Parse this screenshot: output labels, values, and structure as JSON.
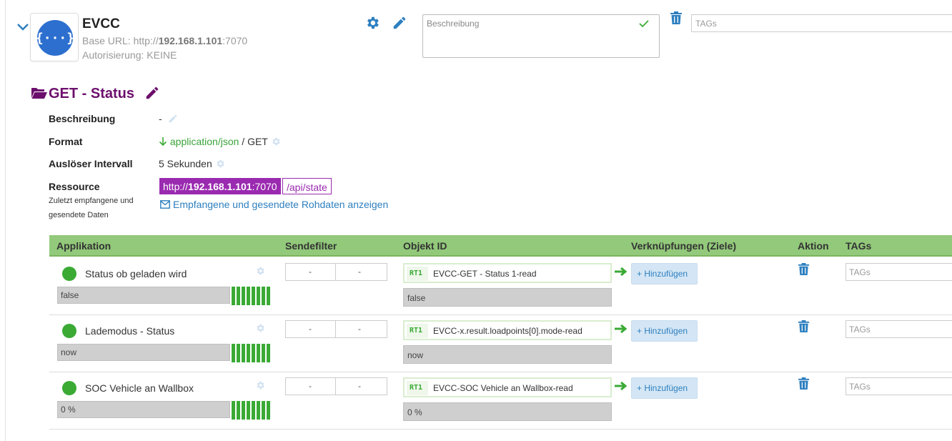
{
  "header": {
    "title": "EVCC",
    "base_url_label": "Base URL: http://",
    "base_url_host": "192.168.1.101",
    "base_url_port": ":7070",
    "auth": "Autorisierung: KEINE",
    "description_placeholder": "Beschreibung",
    "tags_placeholder": "TAGs"
  },
  "section": {
    "title": "GET - Status",
    "beschreibung_label": "Beschreibung",
    "beschreibung_value": "-",
    "format_label": "Format",
    "format_value": "application/json",
    "format_method": "/ GET",
    "intervall_label": "Auslöser Intervall",
    "intervall_value": "5 Sekunden",
    "ressource_label": "Ressource",
    "ressource_sub1": "Zuletzt empfangene und",
    "ressource_sub2": "gesendete Daten",
    "res_prefix": "http://",
    "res_host": "192.168.1.101",
    "res_port": ":7070",
    "res_path": "/api/state",
    "raw_link": "Empfangene und gesendete Rohdaten anzeigen"
  },
  "table": {
    "columns": [
      "Applikation",
      "Sendefilter",
      "Objekt ID",
      "Verknüpfungen (Ziele)",
      "Aktion",
      "TAGs"
    ],
    "rows": [
      {
        "name": "Status ob geladen wird",
        "value": "false",
        "filter_a": "-",
        "filter_b": "-",
        "rt": "RT1",
        "object": "EVCC-GET - Status 1-read",
        "object_value": "false",
        "add_label": "+ Hinzufügen",
        "tags_placeholder": "TAGs"
      },
      {
        "name": "Lademodus - Status",
        "value": "now",
        "filter_a": "-",
        "filter_b": "-",
        "rt": "RT1",
        "object": "EVCC-x.result.loadpoints[0].mode-read",
        "object_value": "now",
        "add_label": "+ Hinzufügen",
        "tags_placeholder": "TAGs"
      },
      {
        "name": "SOC Vehicle an Wallbox",
        "value": "0 %",
        "filter_a": "-",
        "filter_b": "-",
        "rt": "RT1",
        "object": "EVCC-SOC Vehicle an Wallbox-read",
        "object_value": "0 %",
        "add_label": "+ Hinzufügen",
        "tags_placeholder": "TAGs"
      }
    ]
  },
  "colors": {
    "accent": "#2d7fbf",
    "purple": "#9a2ab0",
    "green": "#3aaa35",
    "header_green": "#92c97a"
  }
}
